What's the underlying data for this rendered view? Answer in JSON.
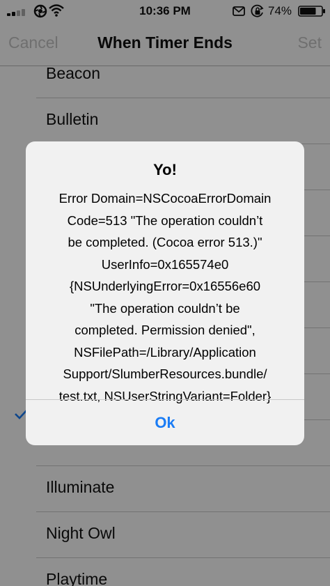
{
  "status_bar": {
    "time": "10:36 PM",
    "battery": "74%",
    "icons": [
      "signal-icon",
      "carrier-icon",
      "wifi-icon",
      "mail-icon",
      "rotation-lock-icon",
      "battery-icon"
    ]
  },
  "nav": {
    "cancel_label": "Cancel",
    "title": "When Timer Ends",
    "set_label": "Set"
  },
  "list": {
    "items_top": [
      "Beacon",
      "Bulletin"
    ],
    "items_bottom": [
      "Illuminate",
      "Night Owl",
      "Playtime"
    ]
  },
  "alert": {
    "title": "Yo!",
    "message_lines": [
      "Error Domain=NSCocoaErrorDomain",
      "Code=513 \"The operation couldn’t",
      "be completed. (Cocoa error 513.)\"",
      "UserInfo=0x165574e0",
      "{NSUnderlyingError=0x16556e60",
      "\"The operation couldn’t be",
      "completed. Permission denied\",",
      "NSFilePath=/Library/Application",
      "Support/SlumberResources.bundle/",
      "test.txt, NSUserStringVariant=Folder}"
    ],
    "ok_label": "Ok"
  },
  "colors": {
    "accent": "#1a7cf5",
    "disabled_nav": "#c4c4c4",
    "overlay": "rgba(0,0,0,0.43)"
  }
}
